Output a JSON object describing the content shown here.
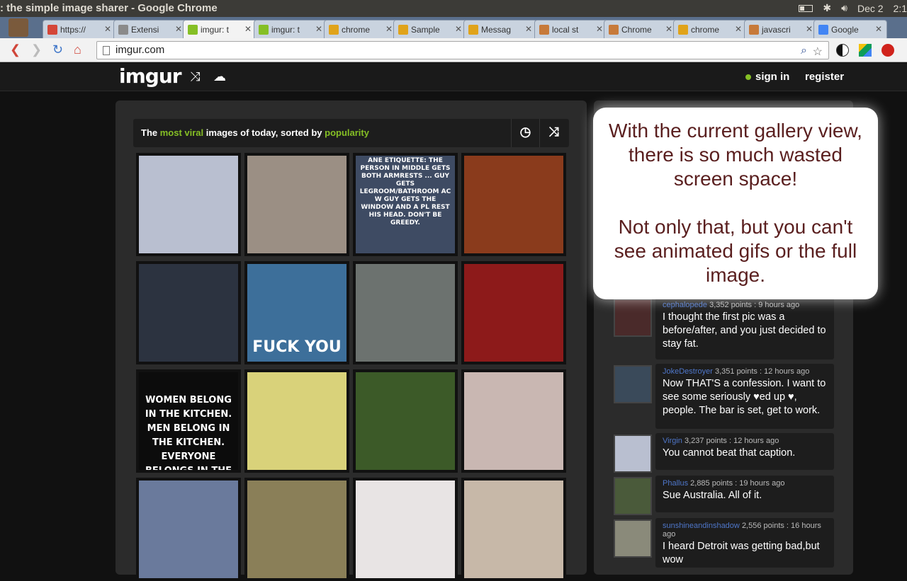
{
  "os": {
    "window_title": ": the simple image sharer - Google Chrome",
    "date": "Dec 2",
    "time": "2:1"
  },
  "tabs": [
    {
      "label": "https://",
      "icon": "gmail-icon",
      "color": "#d44638"
    },
    {
      "label": "Extensi",
      "icon": "puzzle-icon",
      "color": "#8a8a8a"
    },
    {
      "label": "imgur: t",
      "icon": "imgur-icon",
      "color": "#85bf25",
      "active": true
    },
    {
      "label": "imgur: t",
      "icon": "imgur-icon",
      "color": "#85bf25"
    },
    {
      "label": "chrome",
      "icon": "chrome-icon",
      "color": "#e0a31a"
    },
    {
      "label": "Sample",
      "icon": "chrome-icon",
      "color": "#e0a31a"
    },
    {
      "label": "Messag",
      "icon": "chrome-icon",
      "color": "#e0a31a"
    },
    {
      "label": "local st",
      "icon": "doc-icon",
      "color": "#c77a3a"
    },
    {
      "label": "Chrome",
      "icon": "doc-icon",
      "color": "#c77a3a"
    },
    {
      "label": "chrome",
      "icon": "chrome-icon",
      "color": "#e0a31a"
    },
    {
      "label": "javascri",
      "icon": "doc-icon",
      "color": "#c77a3a"
    },
    {
      "label": "Google",
      "icon": "google-icon",
      "color": "#4285f4"
    }
  ],
  "address": {
    "url": "imgur.com"
  },
  "site": {
    "logo": "imgur",
    "sign_in": "sign in",
    "register": "register"
  },
  "sort": {
    "prefix": "The ",
    "viral": "most viral",
    "middle": " images of today, sorted by ",
    "popularity": "popularity"
  },
  "thumbnails": [
    {
      "caption": "",
      "color": "#b9bfd0"
    },
    {
      "caption": "",
      "color": "#9b8f84"
    },
    {
      "caption": "ANE ETIQUETTE: THE PERSON IN MIDDLE GETS BOTH ARMRESTS ... GUY GETS LEGROOM/BATHROOM AC W GUY GETS THE WINDOW AND A PL REST HIS HEAD. DON'T BE GREEDY.",
      "color": "#3e4b63"
    },
    {
      "caption": "",
      "color": "#8a3b1c"
    },
    {
      "caption": "",
      "color": "#2c3340"
    },
    {
      "caption": "FUCK YOU",
      "color": "#3d6f9a"
    },
    {
      "caption": "",
      "color": "#6c726f"
    },
    {
      "caption": "",
      "color": "#8d1a1a"
    },
    {
      "caption": "WOMEN BELONG IN THE KITCHEN. MEN BELONG IN THE KITCHEN. EVERYONE BELONGS IN THE KITCHEN - KITCHEN HAS FOOD.",
      "color": "#0c0c0c"
    },
    {
      "caption": "",
      "color": "#d9d27a"
    },
    {
      "caption": "",
      "color": "#3c5a28"
    },
    {
      "caption": "",
      "color": "#c9b7b2"
    },
    {
      "caption": "",
      "color": "#6a7a9c"
    },
    {
      "caption": "",
      "color": "#8a7f58"
    },
    {
      "caption": "",
      "color": "#e8e4e4"
    },
    {
      "caption": "",
      "color": "#c7b8a8"
    }
  ],
  "comments": [
    {
      "user": "cephalopede",
      "points": "3,352 points",
      "time": "9 hours ago",
      "text": "I thought the first pic was a before/after, and you just decided to stay fat."
    },
    {
      "user": "JokeDestroyer",
      "points": "3,351 points",
      "time": "12 hours ago",
      "text": "Now THAT'S a confession. I want to see some seriously ♥ed up ♥, people. The bar is set, get to work."
    },
    {
      "user": "Virgin",
      "points": "3,237 points",
      "time": "12 hours ago",
      "text": "You cannot beat that caption."
    },
    {
      "user": "Phallus",
      "points": "2,885 points",
      "time": "19 hours ago",
      "text": "Sue Australia. All of it."
    },
    {
      "user": "sunshineandinshadow",
      "points": "2,556 points",
      "time": "16 hours ago",
      "text": "I heard Detroit was getting bad,but wow"
    }
  ],
  "callout": {
    "line1": "With the current gallery view, there is so much wasted screen space!",
    "line2": "Not only that, but you can't see animated gifs or the full image."
  }
}
